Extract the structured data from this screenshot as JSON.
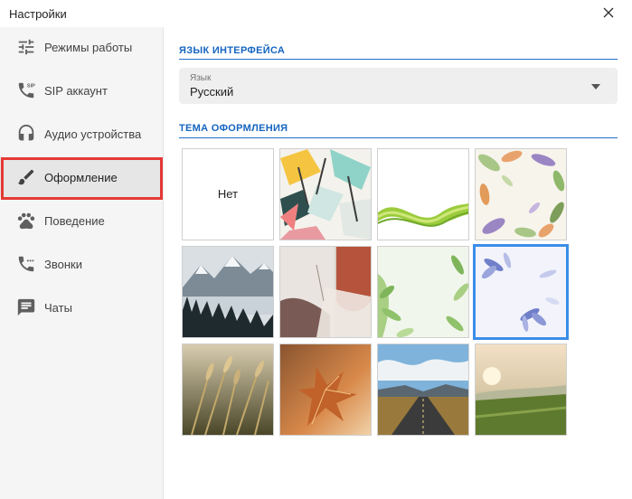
{
  "window": {
    "title": "Настройки"
  },
  "sidebar": {
    "items": [
      {
        "label": "Режимы работы",
        "icon": "sliders-icon"
      },
      {
        "label": "SIP аккаунт",
        "icon": "sip-phone-icon"
      },
      {
        "label": "Аудио устройства",
        "icon": "headphones-icon"
      },
      {
        "label": "Оформление",
        "icon": "brush-icon",
        "active": true
      },
      {
        "label": "Поведение",
        "icon": "paw-icon"
      },
      {
        "label": "Звонки",
        "icon": "call-forward-icon"
      },
      {
        "label": "Чаты",
        "icon": "chat-icon"
      }
    ],
    "sip_badge": "SIP"
  },
  "language": {
    "section_title": "ЯЗЫК ИНТЕРФЕЙСА",
    "field_label": "Язык",
    "value": "Русский"
  },
  "theme": {
    "section_title": "ТЕМА ОФОРМЛЕНИЯ",
    "none_label": "Нет",
    "selected_index": 7,
    "accent_color": "#3b8de8",
    "highlight_color": "#e53935"
  }
}
